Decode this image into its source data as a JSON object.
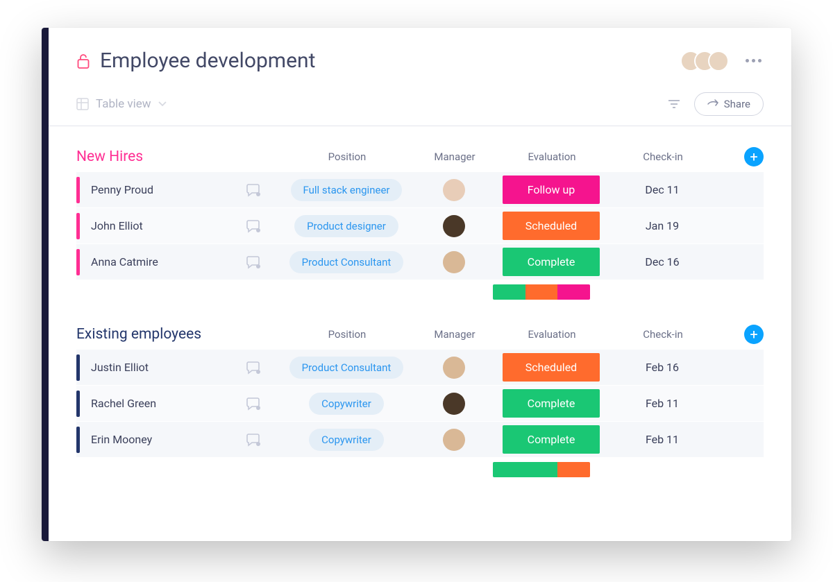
{
  "header": {
    "title": "Employee development"
  },
  "toolbar": {
    "view_label": "Table view",
    "share_label": "Share"
  },
  "columns": {
    "position": "Position",
    "manager": "Manager",
    "evaluation": "Evaluation",
    "checkin": "Check-in"
  },
  "colors": {
    "pink": "#ff2e93",
    "navy": "#23366b",
    "orange": "#ff6b2d",
    "green": "#1ac774",
    "magenta": "#f5148e"
  },
  "groups": [
    {
      "title": "New Hires",
      "title_color": "#ff2e93",
      "marker_color": "#ff2e93",
      "rows": [
        {
          "name": "Penny Proud",
          "position": "Full stack engineer",
          "manager_bg": "ava-bg-1",
          "evaluation": "Follow up",
          "eval_color": "#f5148e",
          "checkin": "Dec 11"
        },
        {
          "name": "John Elliot",
          "position": "Product designer",
          "manager_bg": "ava-bg-2",
          "evaluation": "Scheduled",
          "eval_color": "#ff6b2d",
          "checkin": "Jan 19"
        },
        {
          "name": "Anna Catmire",
          "position": "Product Consultant",
          "manager_bg": "ava-bg-3",
          "evaluation": "Complete",
          "eval_color": "#1ac774",
          "checkin": "Dec 16"
        }
      ],
      "summary": [
        {
          "color": "#1ac774",
          "flex": 1
        },
        {
          "color": "#ff6b2d",
          "flex": 1
        },
        {
          "color": "#f5148e",
          "flex": 1
        }
      ]
    },
    {
      "title": "Existing employees",
      "title_color": "#23366b",
      "marker_color": "#23366b",
      "rows": [
        {
          "name": "Justin Elliot",
          "position": "Product Consultant",
          "manager_bg": "ava-bg-3",
          "evaluation": "Scheduled",
          "eval_color": "#ff6b2d",
          "checkin": "Feb 16"
        },
        {
          "name": "Rachel Green",
          "position": "Copywriter",
          "manager_bg": "ava-bg-2",
          "evaluation": "Complete",
          "eval_color": "#1ac774",
          "checkin": "Feb 11"
        },
        {
          "name": "Erin Mooney",
          "position": "Copywriter",
          "manager_bg": "ava-bg-3",
          "evaluation": "Complete",
          "eval_color": "#1ac774",
          "checkin": "Feb 11"
        }
      ],
      "summary": [
        {
          "color": "#1ac774",
          "flex": 2
        },
        {
          "color": "#ff6b2d",
          "flex": 1
        }
      ]
    }
  ]
}
